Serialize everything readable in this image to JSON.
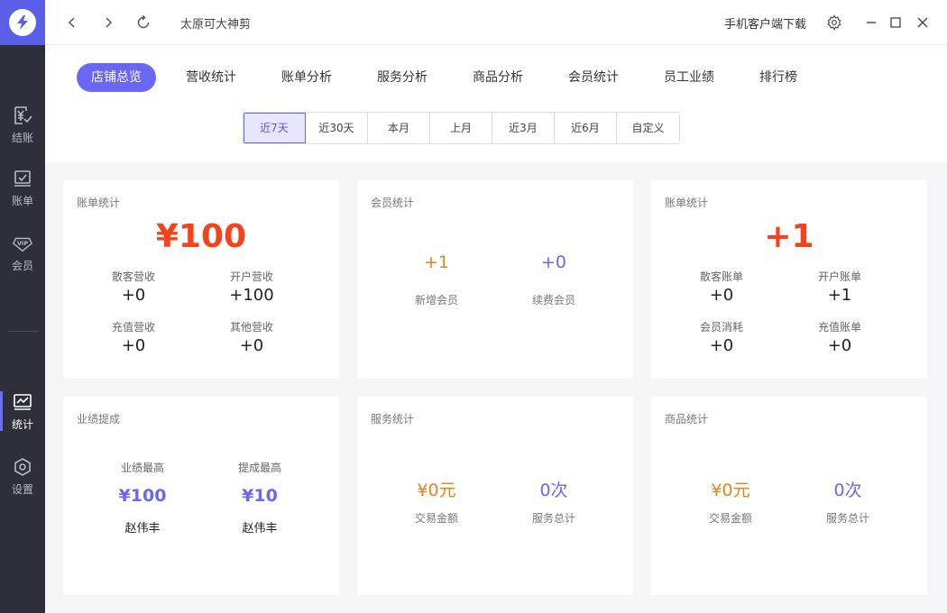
{
  "window": {
    "shop_name": "太原可大神剪",
    "download_label": "手机客户端下载"
  },
  "sidebar": {
    "items": [
      {
        "label": "结账",
        "icon": "yen-checkout-icon"
      },
      {
        "label": "账单",
        "icon": "bill-icon"
      },
      {
        "label": "会员",
        "icon": "vip-icon"
      },
      {
        "label": "统计",
        "icon": "stats-icon"
      },
      {
        "label": "设置",
        "icon": "settings-icon"
      }
    ],
    "active": "统计"
  },
  "tabs": [
    {
      "label": "店铺总览",
      "active": true
    },
    {
      "label": "营收统计"
    },
    {
      "label": "账单分析"
    },
    {
      "label": "服务分析"
    },
    {
      "label": "商品分析"
    },
    {
      "label": "会员统计"
    },
    {
      "label": "员工业绩"
    },
    {
      "label": "排行榜"
    }
  ],
  "periods": [
    {
      "label": "近7天",
      "active": true
    },
    {
      "label": "近30天"
    },
    {
      "label": "本月"
    },
    {
      "label": "上月"
    },
    {
      "label": "近3月"
    },
    {
      "label": "近6月"
    },
    {
      "label": "自定义"
    }
  ],
  "revenue_card": {
    "title": "账单统计",
    "total": "¥100",
    "items": [
      {
        "label": "散客营收",
        "value": "+0"
      },
      {
        "label": "开户营收",
        "value": "+100"
      },
      {
        "label": "充值营收",
        "value": "+0"
      },
      {
        "label": "其他营收",
        "value": "+0"
      }
    ]
  },
  "member_card": {
    "title": "会员统计",
    "new_value": "+1",
    "new_label": "新增会员",
    "renew_value": "+0",
    "renew_label": "续费会员"
  },
  "bill_card": {
    "title": "账单统计",
    "total": "+1",
    "items": [
      {
        "label": "散客账单",
        "value": "+0"
      },
      {
        "label": "开户账单",
        "value": "+1"
      },
      {
        "label": "会员消耗",
        "value": "+0"
      },
      {
        "label": "充值账单",
        "value": "+0"
      }
    ]
  },
  "commission_card": {
    "title": "业绩提成",
    "top_perf_label": "业绩最高",
    "top_perf_value": "¥100",
    "top_perf_name": "赵伟丰",
    "top_comm_label": "提成最高",
    "top_comm_value": "¥10",
    "top_comm_name": "赵伟丰"
  },
  "service_card": {
    "title": "服务统计",
    "amount_value": "¥0元",
    "amount_label": "交易金额",
    "count_value": "0次",
    "count_label": "服务总计"
  },
  "product_card": {
    "title": "商品统计",
    "amount_value": "¥0元",
    "amount_label": "交易金额",
    "count_value": "0次",
    "count_label": "服务总计"
  },
  "colors": {
    "accent": "#6a67f2",
    "sidebar_bg": "#2e3039",
    "highlight_red": "#f4431c",
    "orange": "#f07d1c"
  }
}
